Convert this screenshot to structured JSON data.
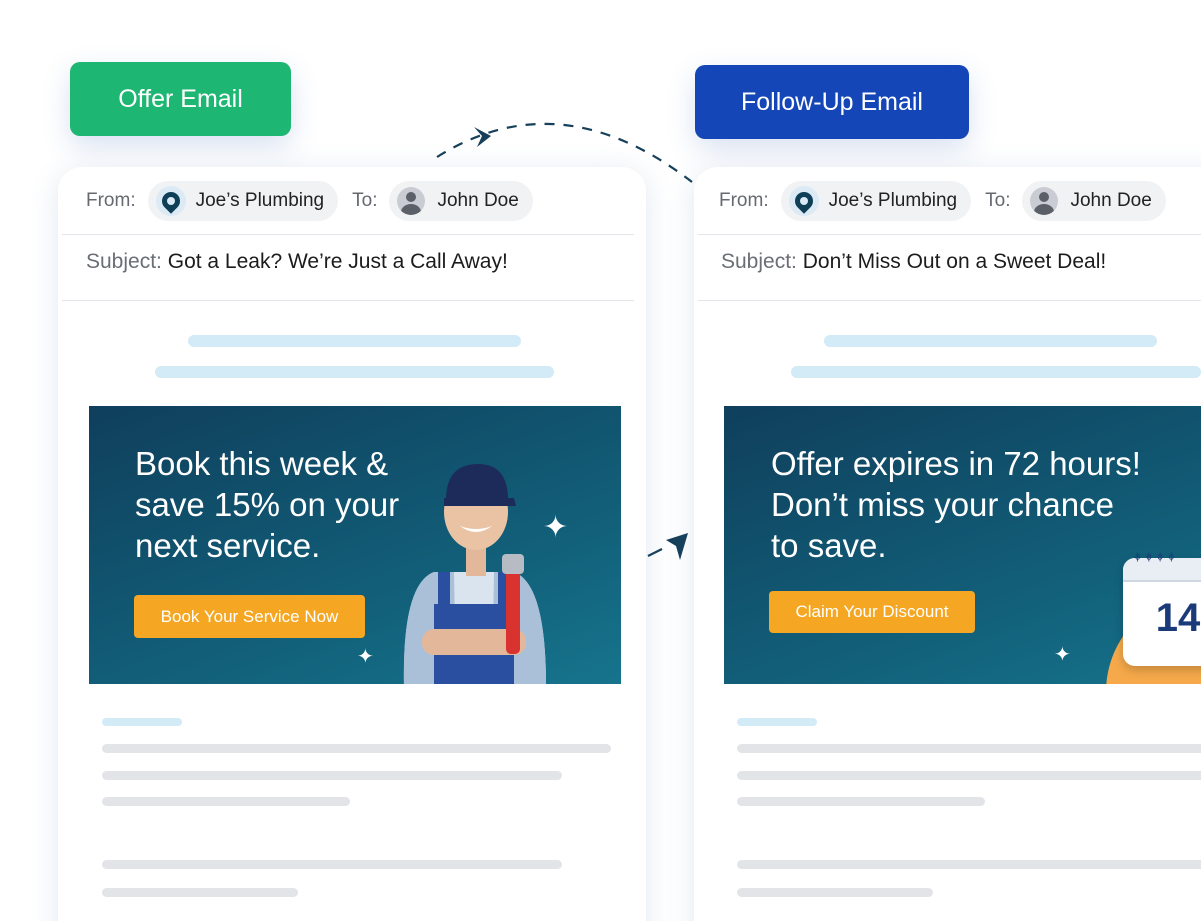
{
  "tags": {
    "offer": "Offer Email",
    "follow_up": "Follow-Up Email"
  },
  "offer_email": {
    "from_label": "From:",
    "from": "Joe’s Plumbing",
    "to_label": "To:",
    "to": "John Doe",
    "subject_label": "Subject:",
    "subject": "Got a Leak? We’re Just a Call Away!",
    "banner_line1": "Book this week &",
    "banner_line2": "save 15% on your",
    "banner_line3": "next service.",
    "cta": "Book Your Service Now"
  },
  "follow_up_email": {
    "from_label": "From:",
    "from": "Joe’s Plumbing",
    "to_label": "To:",
    "to": "John Doe",
    "subject_label": "Subject:",
    "subject": "Don’t Miss Out on a Sweet Deal!",
    "banner_line1": "Offer expires in 72 hours!",
    "banner_line2": "Don’t miss your chance",
    "banner_line3": "to save.",
    "cta": "Claim Your Discount",
    "calendar_day": "14"
  },
  "colors": {
    "offer_tag": "#1eb673",
    "follow_tag": "#1446b8",
    "banner": "#0f4a64",
    "cta": "#f5a623"
  }
}
